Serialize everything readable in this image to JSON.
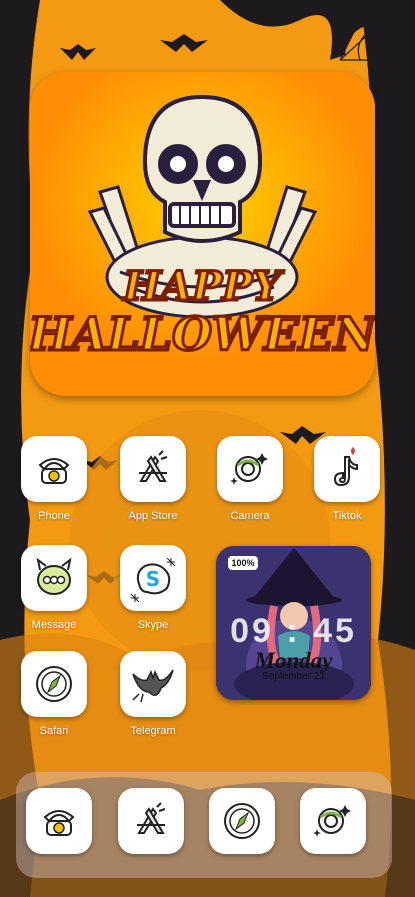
{
  "theme": {
    "accent": "#f39a12",
    "dark": "#1c1a1c"
  },
  "hero": {
    "line1": "HAPPY",
    "line2": "HALLOWEEN"
  },
  "apps": [
    {
      "label": "Phone",
      "icon": "phone-icon"
    },
    {
      "label": "App Store",
      "icon": "app-store-icon"
    },
    {
      "label": "Camera",
      "icon": "camera-icon"
    },
    {
      "label": "Tiktok",
      "icon": "tiktok-icon"
    },
    {
      "label": "Message",
      "icon": "message-icon"
    },
    {
      "label": "Skype",
      "icon": "skype-icon"
    },
    {
      "label": "Safari",
      "icon": "safari-icon"
    },
    {
      "label": "Telegram",
      "icon": "telegram-icon"
    }
  ],
  "clock": {
    "battery": "100%",
    "time": "09 : 45",
    "day": "Monday",
    "date": "September 21"
  },
  "dock": [
    "phone-icon",
    "app-store-icon",
    "safari-icon",
    "camera-icon"
  ]
}
